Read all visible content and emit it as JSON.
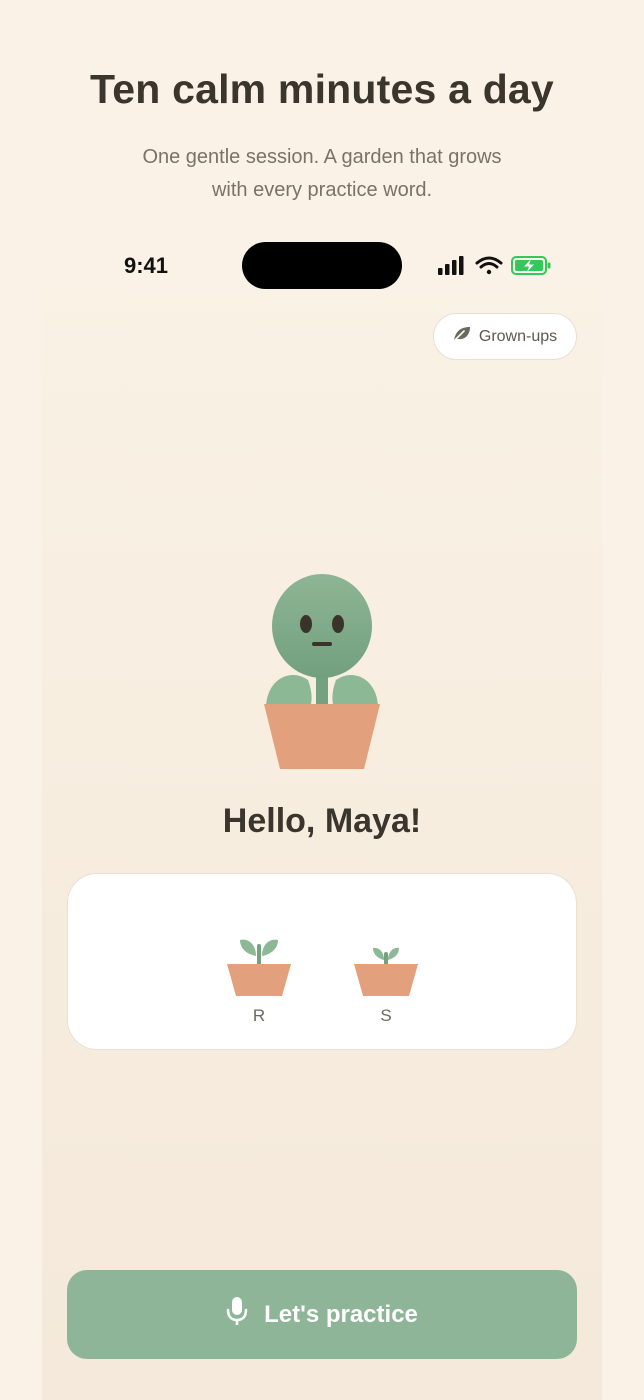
{
  "header": {
    "title": "Ten calm minutes a day",
    "subtitle_line1": "One gentle session. A garden that grows",
    "subtitle_line2": "with every practice word."
  },
  "status_bar": {
    "time": "9:41",
    "icons": [
      "cellular-signal-icon",
      "wifi-icon",
      "battery-charging-icon"
    ],
    "battery_color": "#34c759"
  },
  "grownups_button": {
    "label": "Grown-ups",
    "icon": "leaf-icon"
  },
  "mascot": {
    "name": "potted-plant-mascot"
  },
  "greeting": "Hello, Maya!",
  "sprouts": [
    {
      "label": "R",
      "icon": "sprout-pot-icon"
    },
    {
      "label": "S",
      "icon": "sprout-pot-icon"
    }
  ],
  "practice_button": {
    "label": "Let's practice",
    "icon": "microphone-icon"
  },
  "colors": {
    "background": "#faf2e6",
    "accent_green": "#8fb598",
    "leaf_green": "#86ad90",
    "pot": "#e3a07c",
    "text_dark": "#3a352d"
  }
}
